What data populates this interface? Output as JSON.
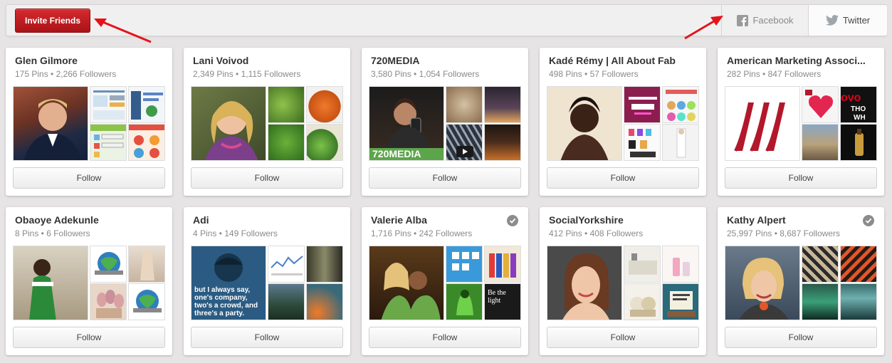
{
  "toolbar": {
    "invite_label": "Invite Friends",
    "facebook_label": "Facebook",
    "twitter_label": "Twitter"
  },
  "cards": [
    {
      "name": "Glen Gilmore",
      "stats": "175 Pins • 2,266 Followers",
      "follow": "Follow"
    },
    {
      "name": "Lani Voivod",
      "stats": "2,349 Pins • 1,115 Followers",
      "follow": "Follow"
    },
    {
      "name": "720MEDIA",
      "stats": "3,580 Pins • 1,054 Followers",
      "follow": "Follow",
      "thumb_caption": "720MEDIA"
    },
    {
      "name": "Kadé Rémy | All About Fab",
      "stats": "498 Pins • 57 Followers",
      "follow": "Follow"
    },
    {
      "name": "American Marketing Associ...",
      "stats": "282 Pins • 847 Followers",
      "follow": "Follow"
    },
    {
      "name": "Obaoye Adekunle",
      "stats": "8 Pins • 6 Followers",
      "follow": "Follow"
    },
    {
      "name": "Adi",
      "stats": "4 Pins • 149 Followers",
      "follow": "Follow",
      "thumb_caption": "but I always say, one's company, two's a crowd, and three's a party."
    },
    {
      "name": "Valerie Alba",
      "stats": "1,716 Pins • 242 Followers",
      "follow": "Follow",
      "verified": true,
      "small_caption": "Be the light"
    },
    {
      "name": "SocialYorkshire",
      "stats": "412 Pins • 408 Followers",
      "follow": "Follow"
    },
    {
      "name": "Kathy Alpert",
      "stats": "25,997 Pins • 8,687 Followers",
      "follow": "Follow",
      "verified": true
    }
  ],
  "colors": {
    "invite_red": "#c21b20",
    "arrow_red": "#e4141b",
    "background": "#e6e4e4"
  }
}
